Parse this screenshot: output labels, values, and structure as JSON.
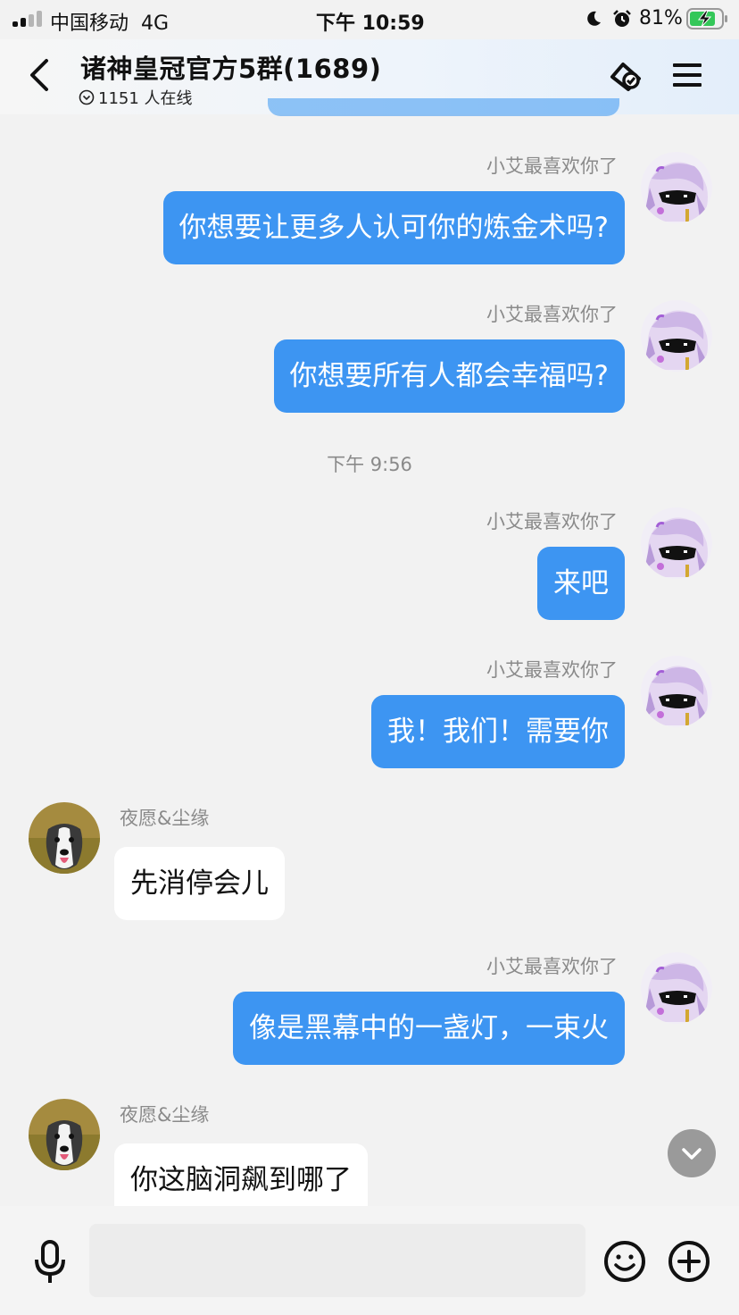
{
  "status_bar": {
    "carrier": "中国移动",
    "network": "4G",
    "time": "下午 10:59",
    "battery_pct": "81%",
    "battery_level": 0.81,
    "signal_bars": 2
  },
  "header": {
    "title": "诸神皇冠官方5群(1689)",
    "online": "1151 人在线"
  },
  "messages": [
    {
      "sender": "小艾最喜欢你了",
      "text": "你想要让更多人认可你的炼金术吗?",
      "side": "self"
    },
    {
      "sender": "小艾最喜欢你了",
      "text": "你想要所有人都会幸福吗?",
      "side": "self"
    },
    {
      "timestamp": "下午 9:56"
    },
    {
      "sender": "小艾最喜欢你了",
      "text": "来吧",
      "side": "self"
    },
    {
      "sender": "小艾最喜欢你了",
      "text": "我！我们！需要你",
      "side": "self"
    },
    {
      "sender": "夜愿&尘缘",
      "text": "先消停会儿",
      "side": "other"
    },
    {
      "sender": "小艾最喜欢你了",
      "text": "像是黑幕中的一盏灯，一束火",
      "side": "self"
    },
    {
      "sender": "夜愿&尘缘",
      "text": "你这脑洞飙到哪了",
      "side": "other"
    }
  ],
  "input": {
    "placeholder": ""
  },
  "icons": {
    "back": "chevron-left-icon",
    "sync": "sync-icon",
    "menu": "menu-icon",
    "mic": "microphone-icon",
    "emoji": "smiley-icon",
    "plus": "plus-icon",
    "scroll_down": "chevron-down-icon"
  },
  "colors": {
    "self_bubble": "#3d95f2",
    "other_bubble": "#ffffff",
    "background": "#f2f2f2",
    "battery_green": "#34c759"
  }
}
